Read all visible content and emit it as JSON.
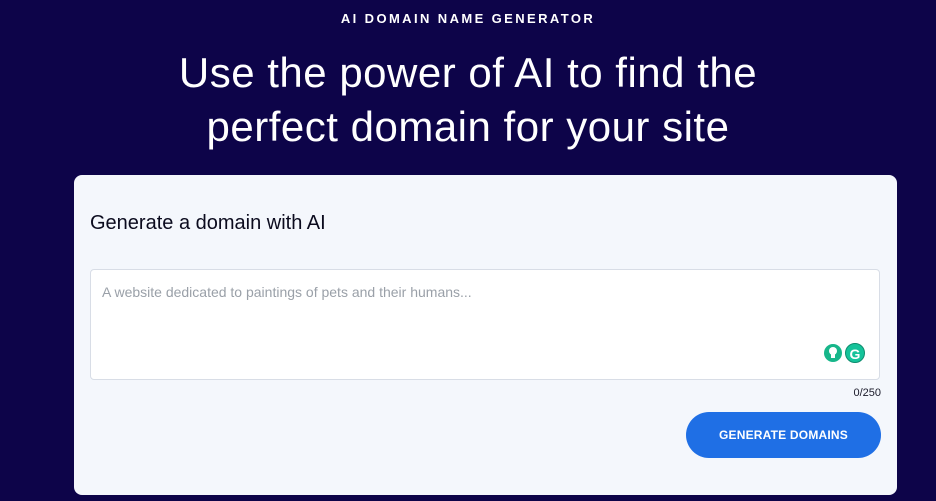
{
  "hero": {
    "eyebrow": "AI DOMAIN NAME GENERATOR",
    "headline_line1": "Use the power of AI to find the",
    "headline_line2": "perfect domain for your site"
  },
  "form": {
    "title": "Generate a domain with AI",
    "input_value": "",
    "input_placeholder": "A website dedicated to paintings of pets and their humans...",
    "char_counter": "0/250",
    "submit_label": "GENERATE DOMAINS"
  },
  "extension_icons": [
    "lightbulb-icon",
    "grammarly-icon"
  ],
  "colors": {
    "background": "#0d0449",
    "card": "#f4f7fc",
    "button": "#1f6fe5",
    "extension_green": "#15c39a"
  }
}
